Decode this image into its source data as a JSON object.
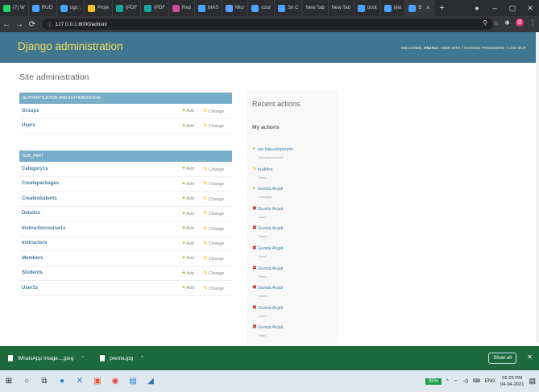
{
  "browser": {
    "tabs": [
      {
        "label": "(7) W",
        "color": "#25d366"
      },
      {
        "label": "RUE!",
        "color": "#4aa3ff"
      },
      {
        "label": "ugc ;",
        "color": "#4aa3ff"
      },
      {
        "label": "Proje",
        "color": "#f5c518"
      },
      {
        "label": "(PDF",
        "color": "#1aa6a0"
      },
      {
        "label": "(PDF",
        "color": "#1aa6a0"
      },
      {
        "label": "Rep",
        "color": "#d04a9b"
      },
      {
        "label": "MAS",
        "color": "#4aa3ff"
      },
      {
        "label": "Micr",
        "color": "#5ea0ff"
      },
      {
        "label": "cour",
        "color": "#4aa3ff"
      },
      {
        "label": "Sri C",
        "color": "#4aa3ff"
      },
      {
        "label": "New Tab",
        "color": ""
      },
      {
        "label": "New Tab",
        "color": ""
      },
      {
        "label": "boot",
        "color": "#4aa3ff"
      },
      {
        "label": "irjet",
        "color": "#4aa3ff"
      },
      {
        "label": "S",
        "color": "#4aa3ff",
        "active": true
      }
    ],
    "new_tab": "+",
    "url": "127.0.0.1:8000/admin/",
    "avatar_letter": "@"
  },
  "header": {
    "title": "Django administration",
    "welcome": "Welcome,",
    "username": "Anjali",
    "links": "View site / Change password / Log out"
  },
  "page_heading": "Site administration",
  "modules": [
    {
      "caption": "Authentication and Authorization",
      "rows": [
        "Groups",
        "Users"
      ]
    },
    {
      "caption": "Sub_part",
      "rows": [
        "Category1s",
        "Createpackages",
        "Createstudents",
        "Detailss",
        "Instructorcourse1s",
        "Instructors",
        "Members",
        "Students",
        "User1s"
      ]
    }
  ],
  "row_actions": {
    "add": "Add",
    "change": "Change"
  },
  "recent": {
    "title": "Recent actions",
    "subtitle": "My actions",
    "items": [
      {
        "type": "add",
        "label": "we bdevelopment",
        "sub": "Instructorcourse1"
      },
      {
        "type": "change",
        "label": "buddha",
        "sub": "User1"
      },
      {
        "type": "add",
        "label": "Gunda Anjali",
        "sub": "Category"
      },
      {
        "type": "delete",
        "label": "Gunda Anjali",
        "sub": "User1"
      },
      {
        "type": "delete",
        "label": "Gunda Anjali",
        "sub": "User1"
      },
      {
        "type": "delete",
        "label": "Gunda Anjali",
        "sub": "User1"
      },
      {
        "type": "delete",
        "label": "Gunda Anjali",
        "sub": "User1"
      },
      {
        "type": "delete",
        "label": "Gunda Anjali",
        "sub": "User1"
      },
      {
        "type": "delete",
        "label": "Gunda Anjali",
        "sub": "User1"
      },
      {
        "type": "delete",
        "label": "Gunda Anjali",
        "sub": "User1"
      }
    ]
  },
  "downloads": {
    "items": [
      "WhatsApp Image....jpeg",
      "prema.jpg"
    ],
    "show_all": "Show all"
  },
  "taskbar": {
    "battery": "95%",
    "lang": "ENG",
    "time": "05:25 PM",
    "date": "04-04-2021"
  }
}
